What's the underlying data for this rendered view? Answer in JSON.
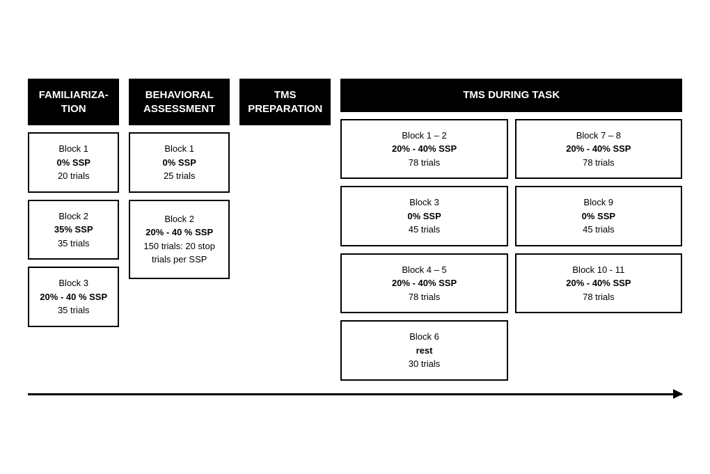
{
  "columns": {
    "familiarization": {
      "header": "FAMILIARIZA-TION",
      "blocks": [
        {
          "title": "Block 1",
          "ssp": "0% SSP",
          "trials": "20 trials"
        },
        {
          "title": "Block 2",
          "ssp": "35% SSP",
          "trials": "35 trials"
        },
        {
          "title": "Block 3",
          "ssp": "20% - 40 % SSP",
          "trials": "35 trials"
        }
      ]
    },
    "behavioral": {
      "header": "BEHAVIORAL ASSESSMENT",
      "blocks": [
        {
          "title": "Block 1",
          "ssp": "0% SSP",
          "trials": "25 trials"
        },
        {
          "title": "Block 2",
          "ssp": "20% - 40 % SSP",
          "trials": "150 trials: 20 stop trials per SSP"
        }
      ]
    },
    "tms": {
      "header": "TMS PREPARATION",
      "blocks": []
    },
    "task": {
      "header": "TMS DURING TASK",
      "left_blocks": [
        {
          "title": "Block 1 – 2",
          "ssp": "20% - 40% SSP",
          "trials": "78 trials"
        },
        {
          "title": "Block 3",
          "ssp": "0% SSP",
          "trials": "45 trials"
        },
        {
          "title": "Block 4 – 5",
          "ssp": "20% - 40% SSP",
          "trials": "78 trials"
        },
        {
          "title": "Block 6",
          "ssp": "rest",
          "trials": "30 trials"
        }
      ],
      "right_blocks": [
        {
          "title": "Block 7 – 8",
          "ssp": "20% - 40% SSP",
          "trials": "78 trials"
        },
        {
          "title": "Block 9",
          "ssp": "0% SSP",
          "trials": "45 trials"
        },
        {
          "title": "Block 10 - 11",
          "ssp": "20% - 40% SSP",
          "trials": "78 trials"
        }
      ]
    }
  }
}
